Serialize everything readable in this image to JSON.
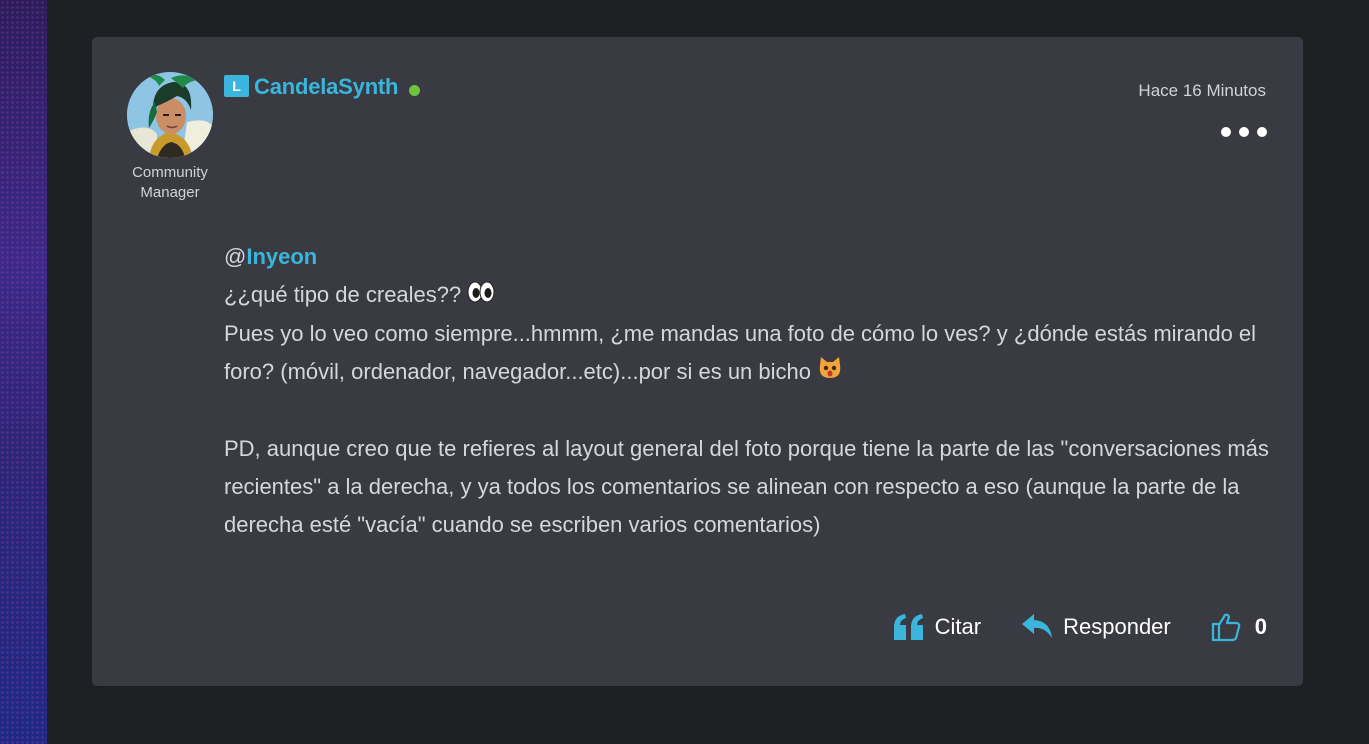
{
  "post": {
    "author": {
      "name": "CandelaSynth",
      "rank_badge": "L",
      "role": "Community Manager",
      "online": true
    },
    "timestamp": "Hace 16 Minutos",
    "body": {
      "mention_prefix": "@",
      "mention": "Inyeon",
      "line1": "¿¿qué tipo de creales??",
      "paragraph1": "Pues yo lo veo como siempre...hmmm, ¿me mandas una foto de cómo lo ves? y ¿dónde estás mirando el foro? (móvil, ordenador, navegador...etc)...por si es un bicho",
      "paragraph2": "PD, aunque creo que te refieres al layout general del foto porque tiene la parte de las \"conversaciones más recientes\" a la derecha, y ya todos los comentarios se alinean con respecto a eso (aunque la parte de la derecha esté \"vacía\" cuando se escriben varios comentarios)"
    },
    "actions": {
      "quote_label": "Citar",
      "reply_label": "Responder",
      "like_count": "0"
    }
  },
  "icons": {
    "more": "more-dots-icon",
    "quote": "quote-icon",
    "reply": "reply-arrow-icon",
    "like": "thumbs-up-icon",
    "eyes": "eyes-emoji",
    "cat": "cat-emoji"
  },
  "colors": {
    "accent": "#3ab6dd",
    "card_bg": "#393a42",
    "page_bg": "#1f2024",
    "online": "#6ec23c"
  }
}
